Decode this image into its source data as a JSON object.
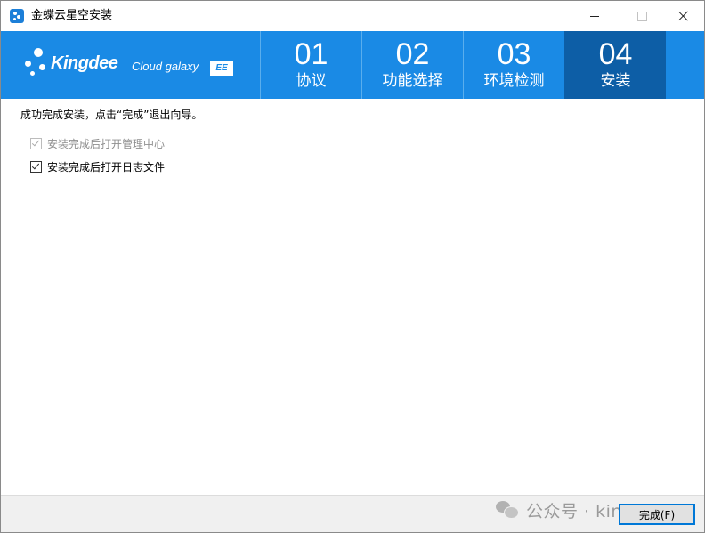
{
  "window": {
    "title": "金蝶云星空安装",
    "icons": {
      "app": "kingdee-app-icon",
      "minimize": "minimize-icon",
      "maximize": "maximize-icon",
      "close": "close-icon"
    }
  },
  "header": {
    "logo": {
      "brand": "Kingdee",
      "product": "Cloud galaxy",
      "edition": "EE"
    },
    "steps": [
      {
        "number": "01",
        "label": "协议",
        "active": false
      },
      {
        "number": "02",
        "label": "功能选择",
        "active": false
      },
      {
        "number": "03",
        "label": "环境检测",
        "active": false
      },
      {
        "number": "04",
        "label": "安装",
        "active": true
      }
    ],
    "colors": {
      "banner": "#1a8ae5",
      "active_step": "#0d5ea6"
    }
  },
  "content": {
    "message": "成功完成安装，点击“完成”退出向导。",
    "options": [
      {
        "label": "安装完成后打开管理中心",
        "checked": true,
        "enabled": false
      },
      {
        "label": "安装完成后打开日志文件",
        "checked": true,
        "enabled": true
      }
    ]
  },
  "footer": {
    "finish_label": "完成(F)",
    "watermark": "公众号 · kingdee"
  }
}
